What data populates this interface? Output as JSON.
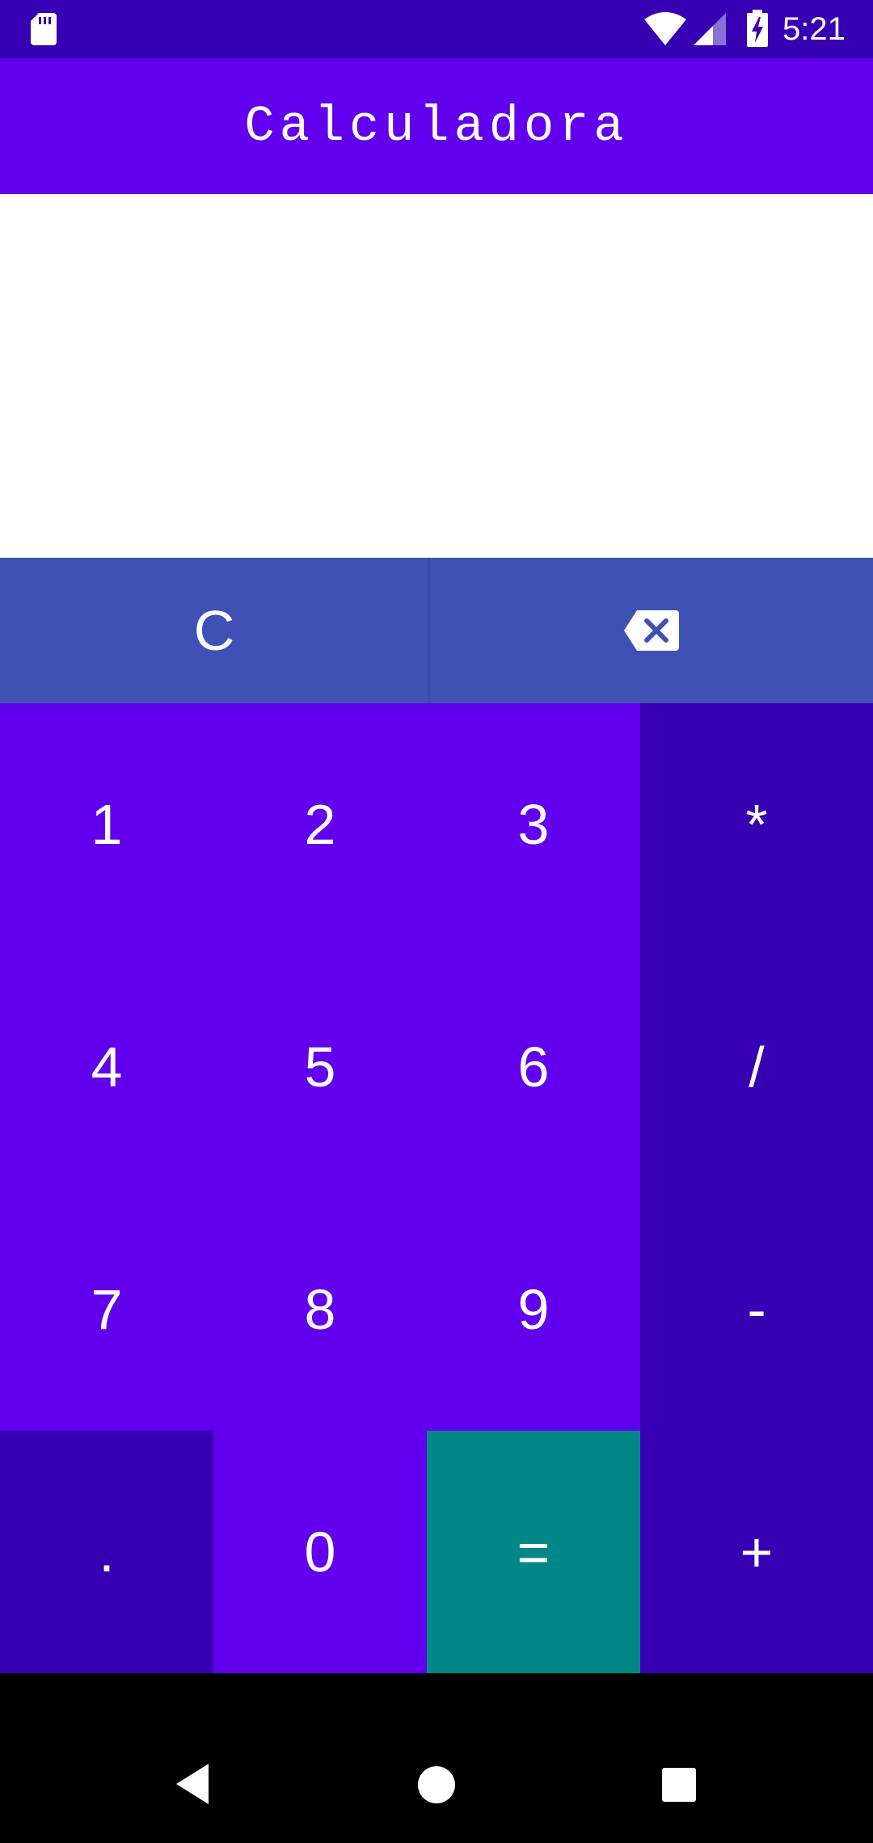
{
  "status_bar": {
    "time": "5:21",
    "icons": [
      "sd-card-icon",
      "wifi-icon",
      "signal-icon",
      "battery-charging-icon"
    ]
  },
  "app_bar": {
    "title": "Calculadora"
  },
  "display": {
    "expression": ""
  },
  "controls": {
    "clear_label": "C",
    "backspace_icon": "backspace-icon"
  },
  "keys": {
    "k1": "1",
    "k2": "2",
    "k3": "3",
    "mul": "*",
    "k4": "4",
    "k5": "5",
    "k6": "6",
    "div": "/",
    "k7": "7",
    "k8": "8",
    "k9": "9",
    "sub": "-",
    "dot": ".",
    "k0": "0",
    "eq": "=",
    "add": "+"
  },
  "nav_bar": {
    "icons": [
      "back-icon",
      "home-icon",
      "recents-icon"
    ]
  },
  "colors": {
    "status_bar": "#3700B3",
    "app_bar": "#6200EE",
    "control_row": "#3F51B5",
    "number_keys": "#6200EE",
    "operator_keys": "#3700B3",
    "equals_key": "#018786",
    "nav_bar": "#000000"
  }
}
